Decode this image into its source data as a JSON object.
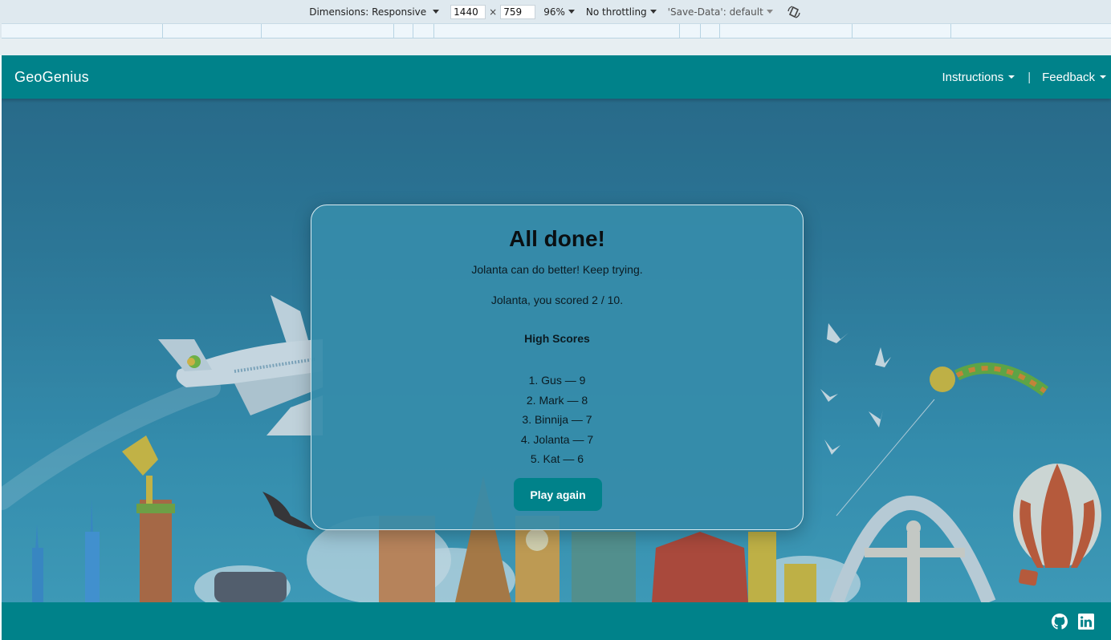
{
  "devtools": {
    "dimensions_label": "Dimensions: Responsive",
    "width_value": "1440",
    "times": "×",
    "height_value": "759",
    "zoom": "96%",
    "throttling": "No throttling",
    "save_data": "'Save-Data': default"
  },
  "navbar": {
    "brand": "GeoGenius",
    "links": [
      {
        "label": "Instructions"
      },
      {
        "label": "Feedback"
      }
    ],
    "separator": "|"
  },
  "modal": {
    "title": "All done!",
    "message": "Jolanta can do better! Keep trying.",
    "score_text": "Jolanta, you scored 2 / 10.",
    "high_scores_title": "High Scores",
    "high_scores": [
      "1. Gus — 9",
      "2. Mark — 8",
      "3. Binnija — 7",
      "4. Jolanta — 7",
      "5. Kat — 6"
    ],
    "play_again_label": "Play again"
  },
  "footer": {
    "icons": [
      "github-icon",
      "linkedin-icon"
    ]
  },
  "colors": {
    "brand_teal": "#00828a",
    "modal_bg": "#368caa",
    "sky_top": "#2b6d8c",
    "sky_bottom": "#45a6c3"
  }
}
